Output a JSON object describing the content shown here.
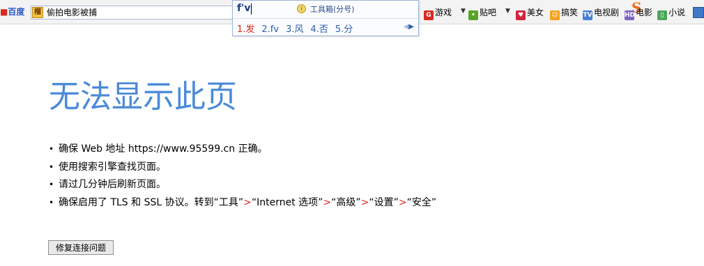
{
  "toolbar": {
    "baidu_logo_text": "百度",
    "search_value": "偷拍电影被捕",
    "links": [
      {
        "label": "游戏",
        "icon": "game-icon",
        "color": "#d62b1f"
      },
      {
        "label": "贴吧",
        "icon": "chat-bubble-icon",
        "color": "#58a427"
      },
      {
        "label": "美女",
        "icon": "lips-icon",
        "color": "#d0263b"
      },
      {
        "label": "搞笑",
        "icon": "smiley-icon",
        "color": "#f4a21c"
      },
      {
        "label": "电视剧",
        "icon": "tv-icon",
        "color": "#4a7fd6"
      },
      {
        "label": "电影",
        "icon": "hd-icon",
        "color": "#7d62c7"
      },
      {
        "label": "小说",
        "icon": "book-icon",
        "color": "#4aa85a"
      }
    ]
  },
  "ime": {
    "composition": "f'v",
    "toolbox_label": "工具箱(分号)",
    "candidates": [
      "1.发",
      "2.fv",
      "3.风",
      "4.否",
      "5.分"
    ]
  },
  "page": {
    "title": "无法显示此页",
    "bullets": [
      "确保 Web 地址 https://www.95599.cn 正确。",
      "使用搜索引擎查找页面。",
      "请过几分钟后刷新页面。"
    ],
    "bullet4": {
      "prefix": "确保启用了 TLS 和 SSL 协议。转到“工具”",
      "parts": [
        "“Internet 选项”",
        "“高级”",
        "“设置”",
        "“安全”"
      ],
      "separator": ">"
    },
    "fix_button": "修复连接问题"
  }
}
